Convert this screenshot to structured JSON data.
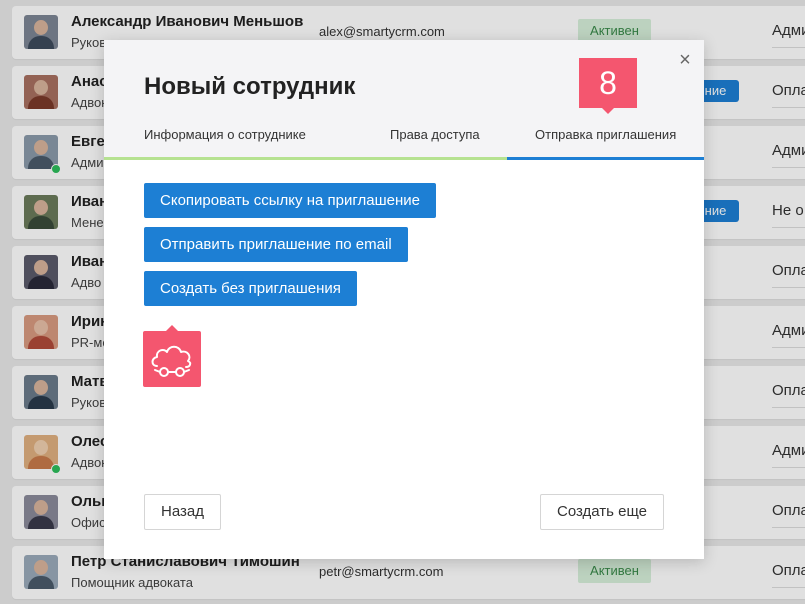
{
  "employees": [
    {
      "name": "Александр Иванович Меньшов",
      "role": "Руков",
      "email": "alex@smartycrm.com",
      "status": "Активен",
      "access": "Адми",
      "online": false,
      "avatar_color": "#4a5568"
    },
    {
      "name": "Анас",
      "role": "Адвок",
      "email": "",
      "status": "",
      "tag": "ние",
      "access": "Опла",
      "online": false,
      "avatar_color": "#8b5a4a"
    },
    {
      "name": "Евге",
      "role": "Адми",
      "email": "",
      "status": "",
      "access": "Адми",
      "online": true,
      "avatar_color": "#6b7c8f"
    },
    {
      "name": "Иван",
      "role": "Мене",
      "email": "",
      "status": "",
      "tag": "ние",
      "access": "Не о",
      "online": false,
      "avatar_color": "#5a6b4a"
    },
    {
      "name": "Иван",
      "role": "Адво",
      "email": "",
      "status": "",
      "access": "Опла",
      "online": false,
      "avatar_color": "#4a4a5a"
    },
    {
      "name": "Ирин",
      "role": "PR-ме",
      "email": "",
      "status": "",
      "access": "Адми",
      "online": false,
      "avatar_color": "#b86a5a"
    },
    {
      "name": "Матв",
      "role": "Руков",
      "email": "",
      "status": "",
      "access": "Опла",
      "online": false,
      "avatar_color": "#3a4a5a"
    },
    {
      "name": "Олес",
      "role": "Адвок",
      "email": "",
      "status": "",
      "access": "Адми",
      "online": true,
      "avatar_color": "#c88a5a"
    },
    {
      "name": "Ольг",
      "role": "Офис",
      "email": "",
      "status": "",
      "access": "Опла",
      "online": false,
      "avatar_color": "#5a5a6a"
    },
    {
      "name": "Петр Станиславович Тимошин",
      "role": "Помощник адвоката",
      "email": "petr@smartycrm.com",
      "status": "Активен",
      "access": "Опла",
      "online": false,
      "avatar_color": "#6a7a8a"
    }
  ],
  "modal": {
    "title": "Новый сотрудник",
    "close_symbol": "×",
    "step_number": "8",
    "tabs": [
      {
        "label": "Информация о сотруднике"
      },
      {
        "label": "Права доступа"
      },
      {
        "label": "Отправка приглашения"
      }
    ],
    "actions": {
      "copy_link": "Скопировать ссылку на приглашение",
      "send_email": "Отправить приглашение по email",
      "create_without": "Создать без приглашения"
    },
    "hint_icon": "cloud-glasses-icon",
    "footer": {
      "back": "Назад",
      "create_more": "Создать еще"
    }
  },
  "colors": {
    "primary_blue": "#1d7fd4",
    "accent_pink": "#f4566f",
    "progress_green": "#b6e291",
    "status_green_bg": "#d7f0da"
  }
}
